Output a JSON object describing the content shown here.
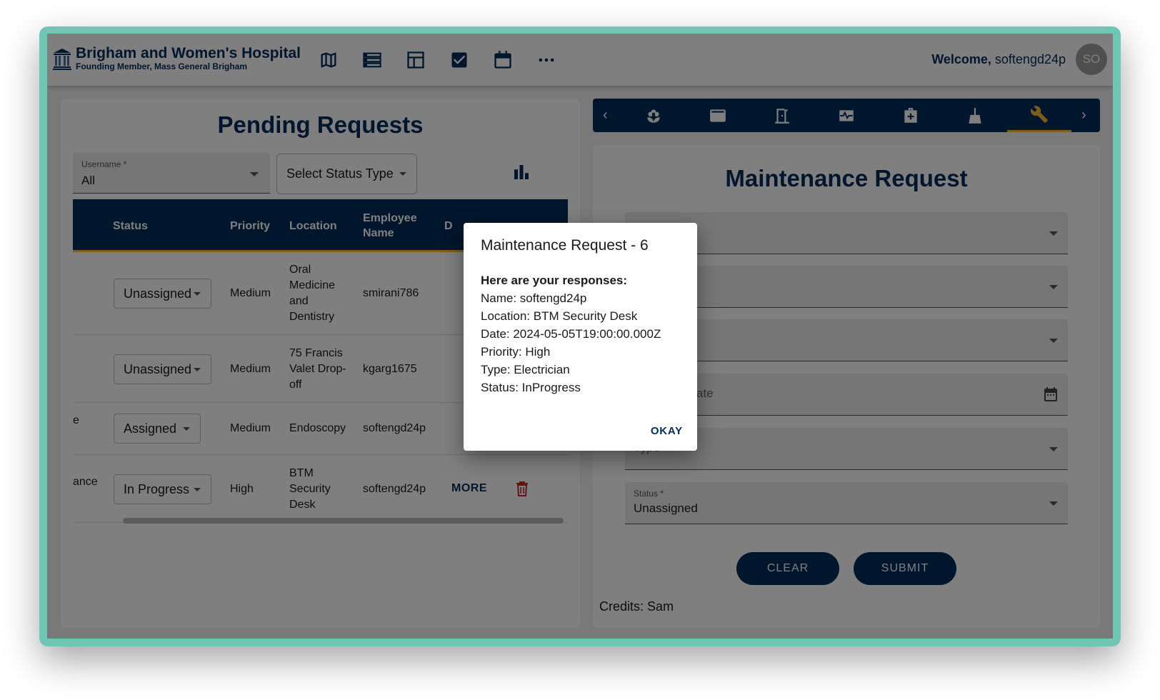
{
  "header": {
    "logo_title": "Brigham and Women's Hospital",
    "logo_subtitle": "Founding Member, Mass General Brigham",
    "nav_icons": [
      "map-icon",
      "list-icon",
      "dashboard-icon",
      "checkbox-icon",
      "calendar-icon",
      "more-icon"
    ],
    "welcome_label": "Welcome,",
    "username": "softengd24p",
    "avatar_initials": "SO"
  },
  "left": {
    "title": "Pending Requests",
    "username_filter": {
      "label": "Username *",
      "value": "All"
    },
    "status_filter_label": "Select Status Type",
    "table": {
      "headers": {
        "status": "Status",
        "priority": "Priority",
        "location": "Location",
        "employee": "Employee Name",
        "col5": "D"
      },
      "rows": [
        {
          "type_frag": "",
          "status": "Unassigned",
          "priority": "Medium",
          "location": "Oral Medicine and Dentistry",
          "employee": "smirani786"
        },
        {
          "type_frag": "",
          "status": "Unassigned",
          "priority": "Medium",
          "location": "75 Francis Valet Drop-off",
          "employee": "kgarg1675"
        },
        {
          "type_frag": "e",
          "status": "Assigned",
          "priority": "Medium",
          "location": "Endoscopy",
          "employee": "softengd24p"
        },
        {
          "type_frag": "ance",
          "status": "In Progress",
          "priority": "High",
          "location": "BTM Security Desk",
          "employee": "softengd24p",
          "more": "MORE"
        }
      ]
    }
  },
  "right": {
    "tabs": [
      "flower-icon",
      "card-icon",
      "door-icon",
      "monitor-heart-icon",
      "medical-bag-icon",
      "broom-icon",
      "wrench-icon"
    ],
    "title": "Maintenance Request",
    "fields": {
      "f1_label": "*",
      "date_placeholder": "ate",
      "type_placeholder": "Type *",
      "status_label": "Status *",
      "status_value": "Unassigned"
    },
    "clear_label": "CLEAR",
    "submit_label": "SUBMIT",
    "credits": "Credits: Sam"
  },
  "dialog": {
    "title": "Maintenance Request - 6",
    "heading": "Here are your responses:",
    "lines": [
      "Name: softengd24p",
      "Location: BTM Security Desk",
      "Date: 2024-05-05T19:00:00.000Z",
      "Priority: High",
      "Type: Electrician",
      "Status: InProgress"
    ],
    "ok_label": "OKAY"
  },
  "colors": {
    "navy": "#012d5a",
    "gold": "#f6bd38",
    "danger": "#c62828",
    "frame": "#6fc6b4"
  }
}
